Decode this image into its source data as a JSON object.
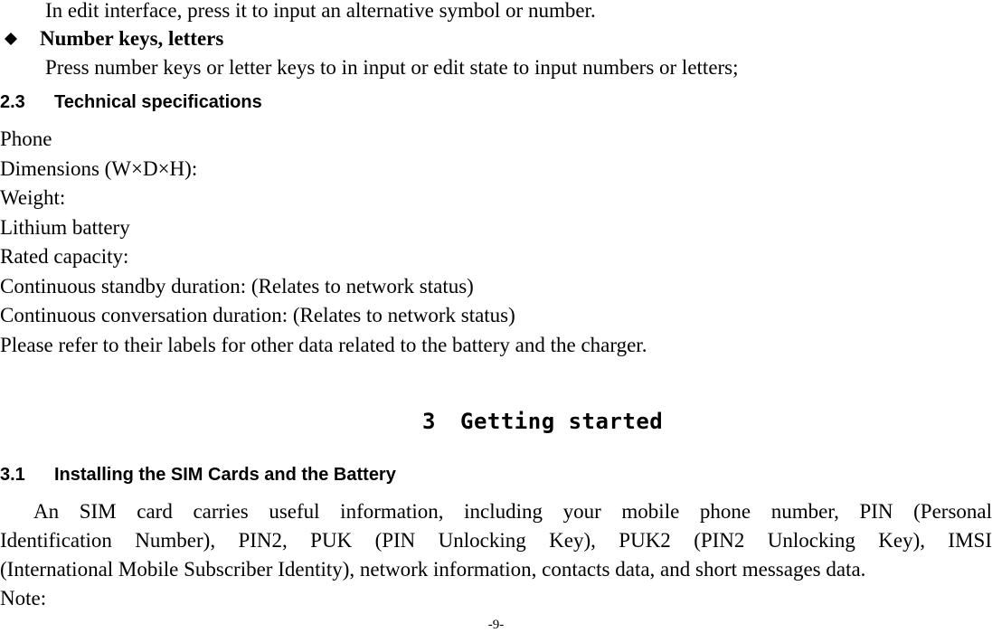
{
  "document": {
    "lines_top": {
      "edit_interface": "In edit interface, press it to input an alternative symbol or number.",
      "number_keys_heading": "Number keys, letters",
      "number_keys_desc": "Press number keys or letter keys to in input or edit state to input numbers or letters;"
    },
    "section_2_3": {
      "number": "2.3",
      "title": "Technical specifications"
    },
    "specs": [
      "Phone",
      "Dimensions (W×D×H):",
      "Weight:",
      "Lithium battery",
      "Rated capacity:",
      "Continuous standby duration: (Relates to network status)",
      "Continuous conversation duration: (Relates to network status)",
      "Please refer to their labels for other data related to the battery and the charger."
    ],
    "chapter_3": {
      "number": "3",
      "title": "Getting started"
    },
    "section_3_1": {
      "number": "3.1",
      "title": "Installing the SIM Cards and the Battery"
    },
    "sim_paragraph_lines": [
      "An SIM card carries useful information, including your mobile phone number, PIN (Personal",
      "Identification Number), PIN2, PUK (PIN Unlocking Key), PUK2 (PIN2 Unlocking Key), IMSI",
      "(International Mobile Subscriber Identity), network information, contacts data, and short messages data."
    ],
    "note_label": "Note:",
    "page_number": "-9-"
  }
}
